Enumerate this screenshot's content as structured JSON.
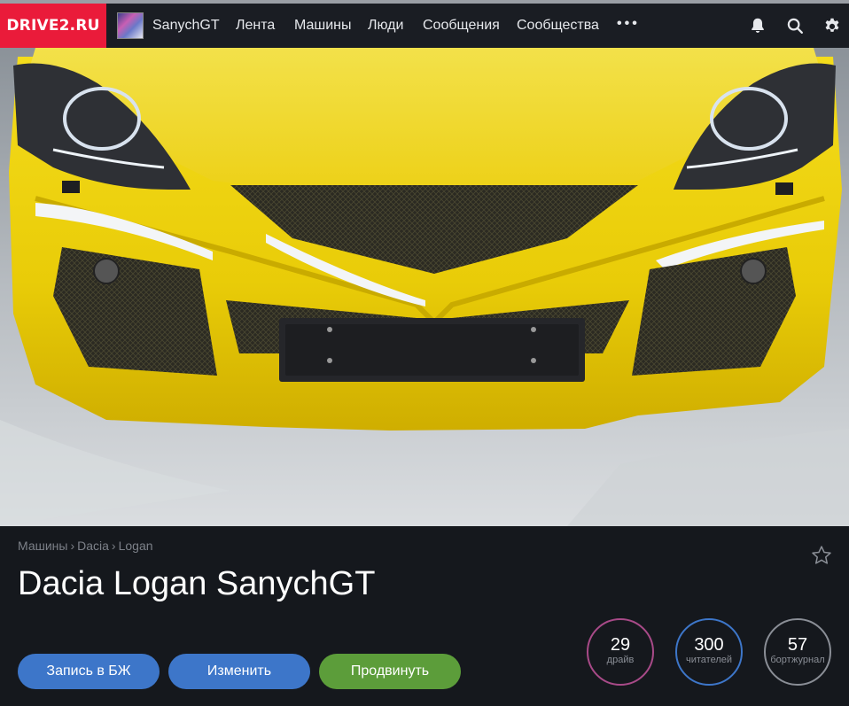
{
  "header": {
    "logo": "DRIVE2.RU",
    "username": "SanychGT",
    "nav": [
      "Лента",
      "Машины",
      "Люди",
      "Сообщения",
      "Сообщества"
    ],
    "more": "•••",
    "icons": [
      "bell-icon",
      "search-icon",
      "gear-icon"
    ]
  },
  "hero": {
    "image": "yellow-car-front-bumper-photo"
  },
  "breadcrumb": [
    "Машины",
    "Dacia",
    "Logan"
  ],
  "breadcrumb_separator": "›",
  "title": "Dacia Logan SanychGT",
  "actions": {
    "post": "Запись в БЖ",
    "edit": "Изменить",
    "promote": "Продвинуть"
  },
  "stats": [
    {
      "value": "29",
      "label": "драйв",
      "color": "#a84a88"
    },
    {
      "value": "300",
      "label": "читателей",
      "color": "#3d76c9"
    },
    {
      "value": "57",
      "label": "бортжурнал",
      "color": "#8a8e96"
    }
  ],
  "colors": {
    "brand": "#ea1b3a",
    "button_blue": "#3d76c9",
    "button_green": "#5c9d3a",
    "navbar_bg": "#1a1d23",
    "page_bg": "#15181d"
  }
}
